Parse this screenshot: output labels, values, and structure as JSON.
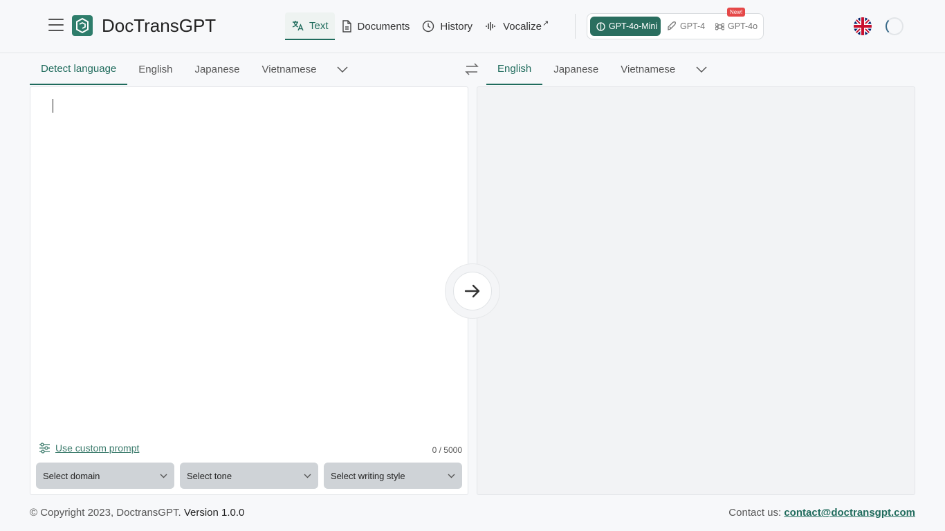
{
  "header": {
    "brand": "DocTransGPT",
    "nav": [
      {
        "label": "Text",
        "icon": "translate-icon"
      },
      {
        "label": "Documents",
        "icon": "document-icon"
      },
      {
        "label": "History",
        "icon": "clock-icon"
      },
      {
        "label": "Vocalize",
        "icon": "sound-wave-icon",
        "suffix": "↗"
      }
    ],
    "models": [
      {
        "label": "GPT-4o-Mini",
        "icon": "brain-icon"
      },
      {
        "label": "GPT-4",
        "icon": "rocket-icon"
      },
      {
        "label": "GPT-4o",
        "icon": "command-icon",
        "badge": "New!"
      }
    ],
    "flag": "uk-flag-icon"
  },
  "source": {
    "tabs": [
      "Detect language",
      "English",
      "Japanese",
      "Vietnamese"
    ],
    "active_tab": "Detect language",
    "text": "",
    "custom_prompt": "Use custom prompt",
    "counter": "0 / 5000",
    "selects": {
      "domain": "Select domain",
      "tone": "Select tone",
      "style": "Select writing style"
    }
  },
  "target": {
    "tabs": [
      "English",
      "Japanese",
      "Vietnamese"
    ],
    "active_tab": "English"
  },
  "footer": {
    "copyright": "© Copyright 2023, DoctransGPT.",
    "version": "Version 1.0.0",
    "contact_label": "Contact us:",
    "contact_email": "contact@doctransgpt.com"
  },
  "colors": {
    "accent": "#1f6b5c",
    "model_active_bg": "#2a6e5f",
    "badge_red": "#e54848"
  }
}
